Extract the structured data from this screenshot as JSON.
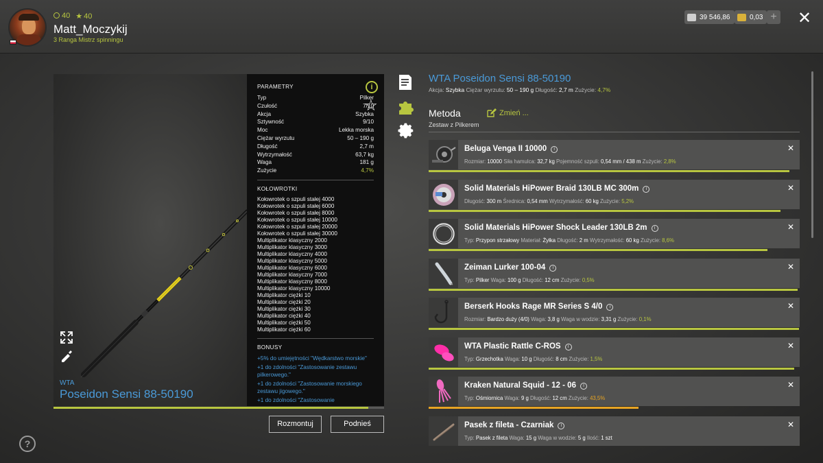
{
  "player": {
    "level": "40",
    "rank_level": "40",
    "name": "Matt_Moczykij",
    "rank_title": "3 Ranga Mistrz spinningu"
  },
  "wallet": {
    "silver": "39 546,86",
    "gold": "0,03",
    "add_label": "+"
  },
  "rod": {
    "brand": "WTA",
    "model": "Poseidon Sensi 88-50190",
    "condition_pct": 0.953,
    "params_title": "PARAMETRY",
    "params": [
      {
        "k": "Typ",
        "v": "Pilker"
      },
      {
        "k": "Czułość",
        "v": "7/10"
      },
      {
        "k": "Akcja",
        "v": "Szybka"
      },
      {
        "k": "Sztywność",
        "v": "9/10"
      },
      {
        "k": "Moc",
        "v": "Lekka morska"
      },
      {
        "k": "Ciężar wyrzutu",
        "v": "50 – 190 g"
      },
      {
        "k": "Długość",
        "v": "2,7 m"
      },
      {
        "k": "Wytrzymałość",
        "v": "63,7 kg"
      },
      {
        "k": "Waga",
        "v": "181 g"
      },
      {
        "k": "Zużycie",
        "v": "4,7%"
      }
    ],
    "reels_title": "KOŁOWROTKI",
    "reels": [
      "Kołowrotek o szpuli stałej 4000",
      "Kołowrotek o szpuli stałej 6000",
      "Kołowrotek o szpuli stałej 8000",
      "Kołowrotek o szpuli stałej 10000",
      "Kołowrotek o szpuli stałej 20000",
      "Kołowrotek o szpuli stałej 30000",
      "Multiplikator klasyczny 2000",
      "Multiplikator klasyczny 3000",
      "Multiplikator klasyczny 4000",
      "Multiplikator klasyczny 5000",
      "Multiplikator klasyczny 6000",
      "Multiplikator klasyczny 7000",
      "Multiplikator klasyczny 8000",
      "Multiplikator klasyczny 10000",
      "Multiplikator ciężki 10",
      "Multiplikator ciężki 20",
      "Multiplikator ciężki 30",
      "Multiplikator ciężki 40",
      "Multiplikator ciężki 50",
      "Multiplikator ciężki 60"
    ],
    "bonus_title": "BONUSY",
    "bonuses": [
      "+5% do umiejętności \"Wędkarstwo morskie\"",
      "+1 do zdolności \"Zastosowanie zestawu pilkerowego.\"",
      "+1 do zdolności \"Zastosowanie morskiego zestawu jigowego.\"",
      "+1 do zdolności \"Zastosowanie"
    ]
  },
  "actions": {
    "dismantle": "Rozmontuj",
    "pick_up": "Podnieś"
  },
  "right": {
    "title": "WTA Poseidon Sensi 88-50190",
    "sub": [
      {
        "k": "Akcja:",
        "v": "Szybka"
      },
      {
        "k": "Ciężar wyrzutu:",
        "v": "50 – 190 g"
      },
      {
        "k": "Długość:",
        "v": "2,7 m"
      },
      {
        "k": "Zużycie:",
        "v": "4,7%",
        "c": "g"
      }
    ],
    "method_label": "Metoda",
    "method_edit": "Zmień ...",
    "method_name": "Zestaw z Pilkerem"
  },
  "items": [
    {
      "name": "Beluga Venga II 10000",
      "thumb": "reel",
      "condition": 0.972,
      "props": [
        {
          "k": "Rozmiar:",
          "v": "10000"
        },
        {
          "k": "Siła hamulca:",
          "v": "32,7 kg"
        },
        {
          "k": "Pojemność szpuli:",
          "v": "0,54 mm / 438 m"
        },
        {
          "k": "Zużycie:",
          "v": "2,8%",
          "c": "g"
        }
      ]
    },
    {
      "name": "Solid Materials HiPower Braid 130LB MC 300m",
      "thumb": "spool",
      "condition": 0.948,
      "props": [
        {
          "k": "Długość:",
          "v": "300 m"
        },
        {
          "k": "Średnica:",
          "v": "0,54 mm"
        },
        {
          "k": "Wytrzymałość:",
          "v": "60 kg"
        },
        {
          "k": "Zużycie:",
          "v": "5,2%",
          "c": "g"
        }
      ]
    },
    {
      "name": "Solid Materials HiPower Shock Leader 130LB 2m",
      "thumb": "coil",
      "condition": 0.914,
      "props": [
        {
          "k": "Typ:",
          "v": "Przypon strzałowy"
        },
        {
          "k": "Materiał:",
          "v": "Żyłka"
        },
        {
          "k": "Długość:",
          "v": "2 m"
        },
        {
          "k": "Wytrzymałość:",
          "v": "60 kg"
        },
        {
          "k": "Zużycie:",
          "v": "8,6%",
          "c": "g"
        }
      ]
    },
    {
      "name": "Zeiman Lurker 100-04",
      "thumb": "jig",
      "condition": 0.995,
      "props": [
        {
          "k": "Typ:",
          "v": "Pilker"
        },
        {
          "k": "Waga:",
          "v": "100 g"
        },
        {
          "k": "Długość:",
          "v": "12 cm"
        },
        {
          "k": "Zużycie:",
          "v": "0,5%",
          "c": "g"
        }
      ]
    },
    {
      "name": "Berserk Hooks Rage MR Series S 4/0",
      "thumb": "hook",
      "condition": 0.999,
      "props": [
        {
          "k": "Rozmiar:",
          "v": "Bardzo duży (4/0)"
        },
        {
          "k": "Waga:",
          "v": "3,8 g"
        },
        {
          "k": "Waga w wodzie:",
          "v": "3,31 g"
        },
        {
          "k": "Zużycie:",
          "v": "0,1%",
          "c": "g"
        }
      ]
    },
    {
      "name": "WTA Plastic Rattle C-ROS",
      "thumb": "rattle",
      "condition": 0.985,
      "props": [
        {
          "k": "Typ:",
          "v": "Grzechotka"
        },
        {
          "k": "Waga:",
          "v": "10 g"
        },
        {
          "k": "Długość:",
          "v": "8 cm"
        },
        {
          "k": "Zużycie:",
          "v": "1,5%",
          "c": "g"
        }
      ]
    },
    {
      "name": "Kraken Natural Squid - 12 - 06",
      "thumb": "squid",
      "condition": 0.565,
      "props": [
        {
          "k": "Typ:",
          "v": "Ośmiornica"
        },
        {
          "k": "Waga:",
          "v": "9 g"
        },
        {
          "k": "Długość:",
          "v": "12 cm"
        },
        {
          "k": "Zużycie:",
          "v": "43,5%",
          "c": "o"
        }
      ]
    },
    {
      "name": "Pasek z fileta - Czarniak",
      "thumb": "strip",
      "condition": null,
      "props": [
        {
          "k": "Typ:",
          "v": "Pasek z fileta"
        },
        {
          "k": "Waga:",
          "v": "15 g"
        },
        {
          "k": "Waga w wodzie:",
          "v": "5 g"
        },
        {
          "k": "Ilość:",
          "v": "1 szt"
        }
      ]
    }
  ],
  "help_label": "?"
}
